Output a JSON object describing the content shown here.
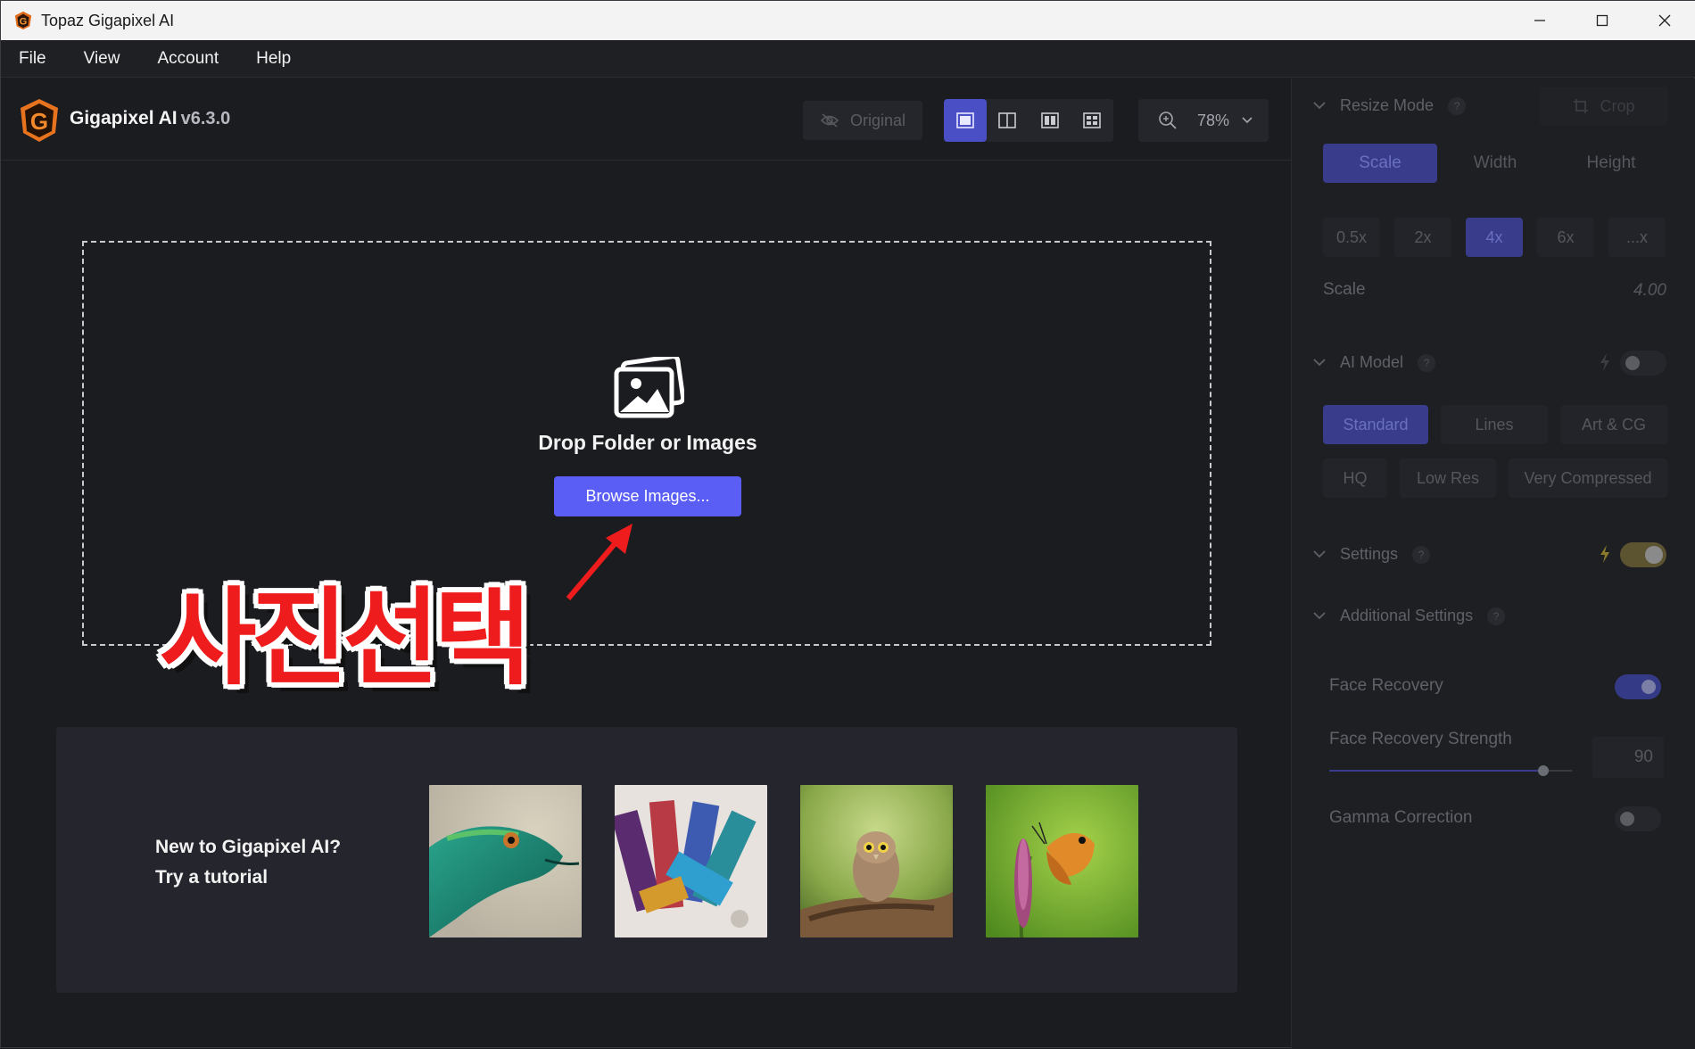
{
  "window": {
    "title": "Topaz Gigapixel AI"
  },
  "menu": [
    "File",
    "View",
    "Account",
    "Help"
  ],
  "header": {
    "app_name": "Gigapixel AI",
    "version": "v6.3.0",
    "original_label": "Original",
    "zoom": "78%"
  },
  "dropzone": {
    "text": "Drop Folder or Images",
    "browse_label": "Browse Images..."
  },
  "annotation": {
    "text": "사진선택"
  },
  "tutorial": {
    "line1": "New to Gigapixel AI?",
    "line2": "Try a tutorial",
    "thumbnails": [
      "lizard",
      "paint brushes",
      "owl",
      "butterfly"
    ]
  },
  "panel": {
    "resize_mode": {
      "title": "Resize Mode",
      "help": "?",
      "crop_label": "Crop",
      "tabs": [
        "Scale",
        "Width",
        "Height"
      ],
      "active_tab": "Scale",
      "scales": [
        "0.5x",
        "2x",
        "4x",
        "6x",
        "...x"
      ],
      "active_scale": "4x",
      "scale_label": "Scale",
      "scale_value": "4.00"
    },
    "ai_model": {
      "title": "AI Model",
      "help": "?",
      "models_row1": [
        "Standard",
        "Lines",
        "Art & CG"
      ],
      "models_row2": [
        "HQ",
        "Low Res",
        "Very Compressed"
      ],
      "active_model": "Standard"
    },
    "settings": {
      "title": "Settings",
      "help": "?"
    },
    "additional": {
      "title": "Additional Settings",
      "help": "?",
      "face_recovery_label": "Face Recovery",
      "face_recovery_on": true,
      "strength_label": "Face Recovery Strength",
      "strength_value": "90",
      "gamma_label": "Gamma Correction",
      "gamma_on": false
    }
  },
  "colors": {
    "accent": "#5a5ef5",
    "accent_dim": "#383c8a",
    "background": "#1b1c20",
    "annotation_red": "#ee1c1c"
  }
}
